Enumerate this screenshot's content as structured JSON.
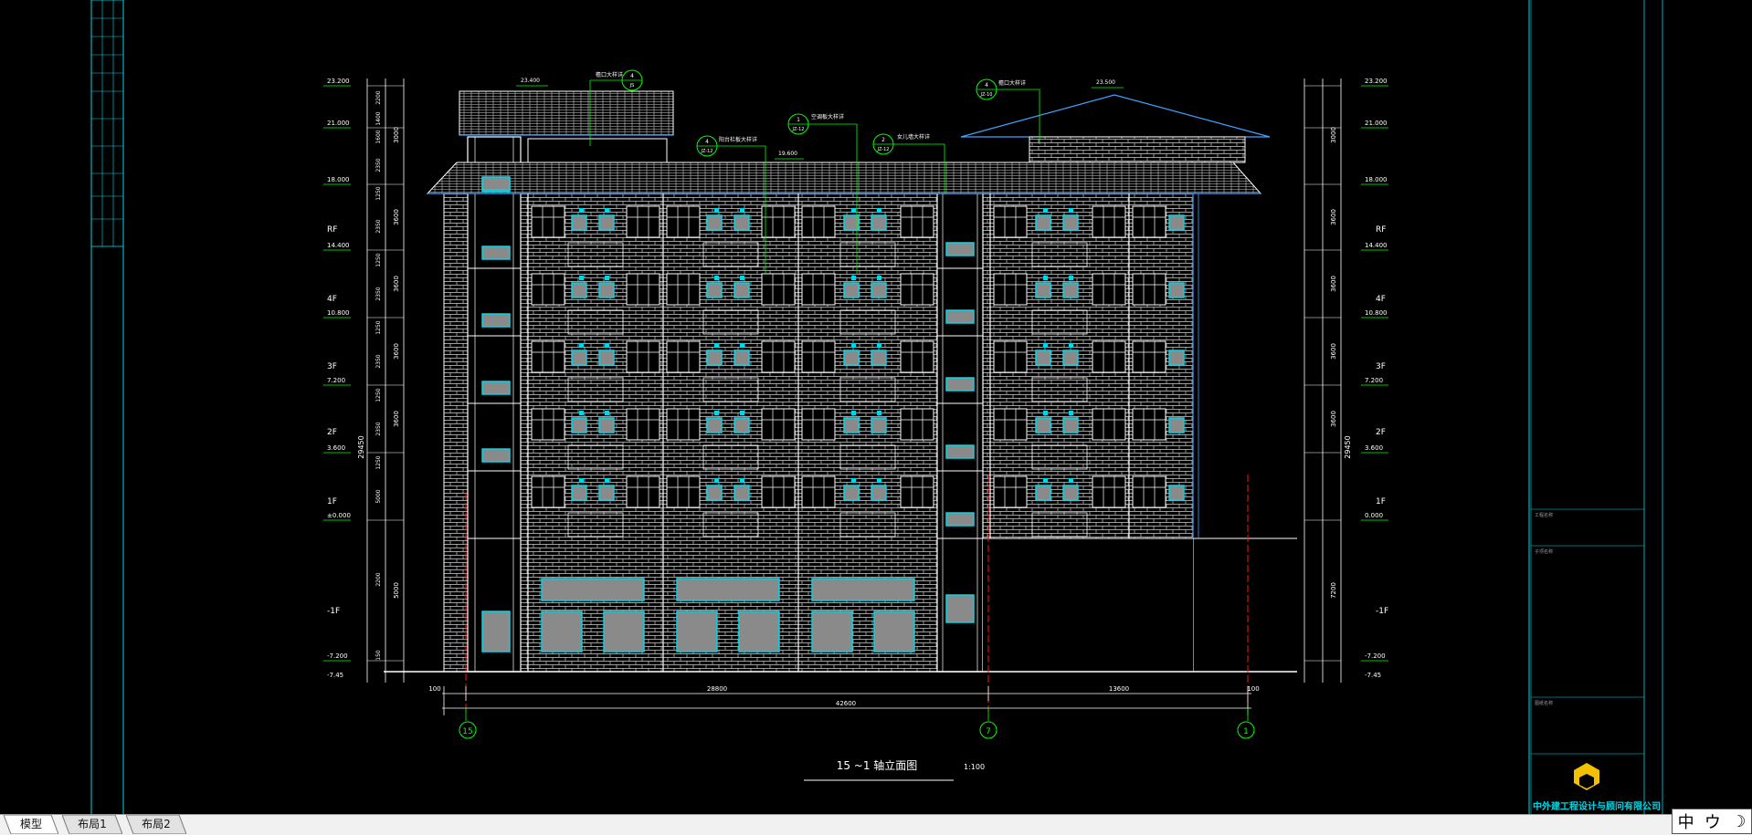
{
  "drawing": {
    "title": "15 ~1 轴立面图",
    "scale": "1:100",
    "company": "中外建工程设计与顾问有限公司",
    "overall_width": "42600",
    "dim_segments": [
      "100",
      "28800",
      "13600",
      "100"
    ],
    "axes": [
      "15",
      "7",
      "1"
    ],
    "total_height": "29450",
    "top_levels": [
      "23.200",
      "21.000",
      "18.000"
    ],
    "roof_levels": [
      "23.400",
      "23.500",
      "19.600"
    ],
    "floor_labels": [
      "RF",
      "4F",
      "3F",
      "2F",
      "1F",
      "-1F"
    ],
    "floor_levels": [
      "14.400",
      "10.800",
      "7.200",
      "3.600",
      "±0.000",
      "-7.200"
    ],
    "floor_levels_right": [
      "14.400",
      "10.800",
      "7.200",
      "3.600",
      "0.000",
      "-7.200"
    ],
    "ground_level": "-7.45",
    "left_dims": [
      "2200",
      "1400",
      "1600",
      "2350",
      "1250",
      "2350",
      "1250",
      "2350",
      "1250",
      "2350",
      "1250",
      "2350",
      "1250",
      "5000",
      "2200",
      "150"
    ],
    "left_story_dims": [
      "3000",
      "3600",
      "3600",
      "3600",
      "3600",
      "5000"
    ],
    "right_story_dims": [
      "3000",
      "3600",
      "3600",
      "3600",
      "3600",
      "7200"
    ],
    "callouts": [
      {
        "num": "4",
        "ref": "JS",
        "text": "檐口大样详"
      },
      {
        "num": "4",
        "ref": "JZ-12",
        "text": "阳台栏板大样详"
      },
      {
        "num": "1",
        "ref": "JZ-12",
        "text": "空调板大样详"
      },
      {
        "num": "2",
        "ref": "JZ-12",
        "text": "女儿墙大样详"
      },
      {
        "num": "4",
        "ref": "JZ-10",
        "text": "檐口大样详"
      }
    ],
    "title_block_rows": [
      "工程名称",
      "子项名称",
      "图纸名称"
    ]
  },
  "tabs": [
    {
      "label": "模型",
      "active": true
    },
    {
      "label": "布局1",
      "active": false
    },
    {
      "label": "布局2",
      "active": false
    }
  ],
  "ime": {
    "lang": "中",
    "symbols": "ウ",
    "moon": "☽"
  },
  "colors": {
    "line": "#ffffff",
    "cyan": "#00d6e6",
    "green": "#00ff00",
    "blue": "#3fa3ff",
    "red": "#ff1010",
    "gray": "#8a8a8a"
  }
}
